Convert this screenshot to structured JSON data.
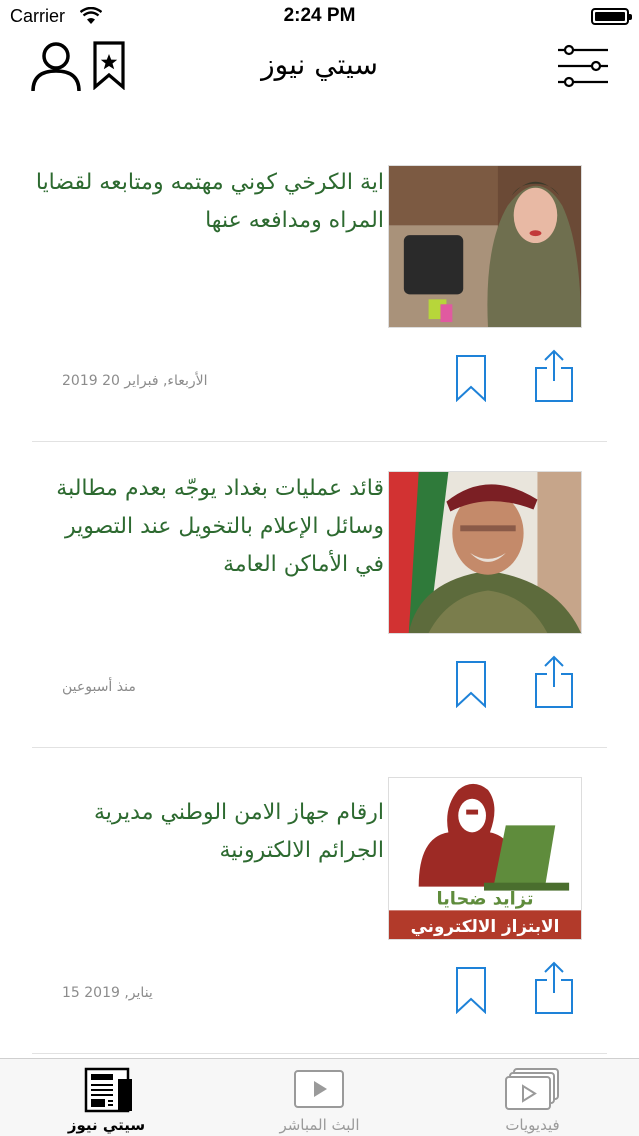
{
  "status_bar": {
    "carrier": "Carrier",
    "time": "2:24 PM"
  },
  "header": {
    "title": "سيتي نيوز"
  },
  "icons": {
    "user": "user-icon",
    "saved": "bookmark-star-icon",
    "filter": "filter-sliders-icon",
    "bookmark": "bookmark-icon",
    "share": "share-icon"
  },
  "news": [
    {
      "headline": "اية الكرخي كوني مهتمه ومتابعه لقضايا المراه ومدافعه عنها",
      "date": "الأربعاء, فبراير 20 2019"
    },
    {
      "headline": "قائد عمليات بغداد يوجّه بعدم مطالبة وسائل الإعلام بالتخويل عند التصوير في الأماكن العامة",
      "date": "منذ أسبوعين"
    },
    {
      "headline": "ارقام جهاز الامن الوطني مديرية الجرائم الالكترونية",
      "date": "15 يناير, 2019",
      "image_text": {
        "line1": "تزايد ضحايا",
        "line2": "الابتزاز الالكتروني"
      }
    }
  ],
  "tabs": [
    {
      "label": "فيديويات",
      "icon": "video-library-icon"
    },
    {
      "label": "البث المباشر",
      "icon": "play-icon"
    },
    {
      "label": "سيتي نيوز",
      "icon": "newspaper-icon"
    }
  ],
  "colors": {
    "headline": "#2d6a30",
    "date": "#8c8c8c",
    "action_icon": "#1e82d8"
  }
}
